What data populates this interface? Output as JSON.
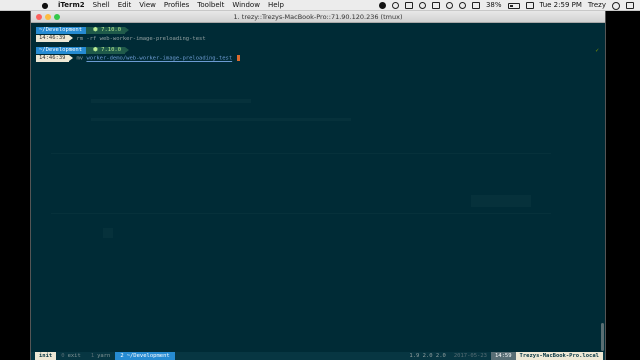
{
  "menubar": {
    "app_name": "iTerm2",
    "items": [
      "Shell",
      "Edit",
      "View",
      "Profiles",
      "Toolbelt",
      "Window",
      "Help"
    ],
    "battery": "38%",
    "clock": "Tue 2:59 PM",
    "user": "Trezy"
  },
  "window": {
    "title": "1. trezy::Trezys-MacBook-Pro::71.90.120.236 (tmux)"
  },
  "prompt1": {
    "dir": "~/Development",
    "node": "⬢ 7.10.0",
    "time": "14:46:39",
    "command": "rm -rf web-worker-image-preloading-test"
  },
  "prompt2": {
    "dir": "~/Development",
    "node": "⬢ 7.10.0",
    "time": "14:46:39",
    "command": "mv",
    "arg": "worker-demo/web-worker-image-preloading-test",
    "check": "✓"
  },
  "tmux": {
    "session": "init",
    "windows": [
      {
        "num": "0",
        "name": "exit",
        "active": false
      },
      {
        "num": "1",
        "name": "yarn",
        "active": false
      },
      {
        "num": "2",
        "name": "~/Development",
        "active": true
      }
    ],
    "load": "1.9 2.0 2.0",
    "date": "2017-05-23",
    "time": "14:59",
    "host": "Trezys-MacBook-Pro.local"
  },
  "colors": {
    "terminal_bg": "#002b36",
    "dir_segment": "#268bd2",
    "node_segment": "#1f5a4a",
    "cursor": "#dc6b2f"
  }
}
